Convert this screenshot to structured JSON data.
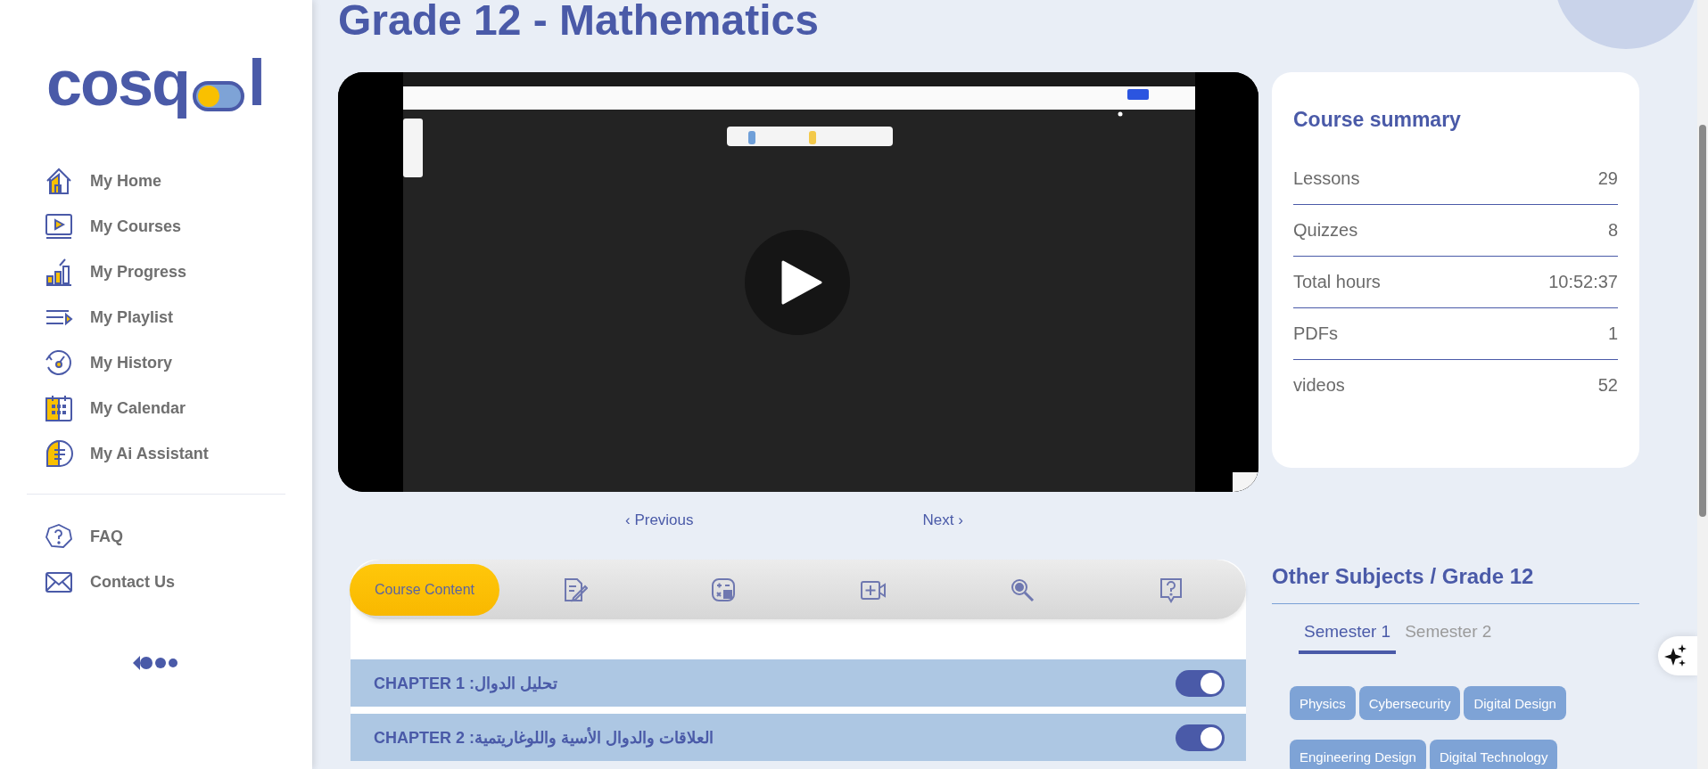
{
  "brand": {
    "text_start": "cosq",
    "text_end": "l"
  },
  "nav": [
    {
      "label": "My Home"
    },
    {
      "label": "My Courses"
    },
    {
      "label": "My Progress"
    },
    {
      "label": "My Playlist"
    },
    {
      "label": "My History"
    },
    {
      "label": "My Calendar"
    },
    {
      "label": "My Ai Assistant"
    }
  ],
  "help": [
    {
      "label": "FAQ"
    },
    {
      "label": "Contact Us"
    }
  ],
  "title": "Grade 12 - Mathematics",
  "pager": {
    "previous": "‹ Previous",
    "next": "Next ›"
  },
  "content_tabs": [
    {
      "label": "Course Content",
      "selected": true
    },
    {
      "selected": false
    },
    {
      "selected": false
    },
    {
      "selected": false
    },
    {
      "selected": false
    },
    {
      "selected": false
    }
  ],
  "chapters": [
    {
      "title": "CHAPTER 1 :تحليل الدوال",
      "on": true
    },
    {
      "title": "CHAPTER 2 :العلاقات والدوال الأسية واللوغاريتمية",
      "on": true
    }
  ],
  "summary": {
    "title": "Course summary",
    "rows": [
      {
        "label": "Lessons",
        "value": "29"
      },
      {
        "label": "Quizzes",
        "value": "8"
      },
      {
        "label": "Total hours",
        "value": "10:52:37"
      },
      {
        "label": "PDFs",
        "value": "1"
      },
      {
        "label": "videos",
        "value": "52"
      }
    ]
  },
  "other_subjects": {
    "title": "Other Subjects / Grade 12",
    "semesters": [
      {
        "label": "Semester 1",
        "selected": true
      },
      {
        "label": "Semester 2",
        "selected": false
      }
    ],
    "subjects": [
      "Physics",
      "Cybersecurity",
      "Digital Design",
      "Engineering Design",
      "Digital Technology"
    ]
  }
}
